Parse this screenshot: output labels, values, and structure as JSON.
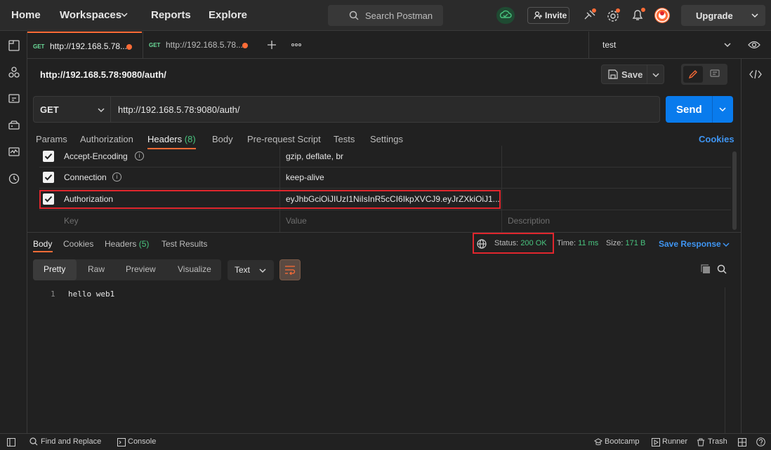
{
  "nav": {
    "home": "Home",
    "workspaces": "Workspaces",
    "reports": "Reports",
    "explore": "Explore",
    "search_placeholder": "Search Postman",
    "invite": "Invite",
    "upgrade": "Upgrade"
  },
  "tabs": [
    {
      "method": "GET",
      "url": "http://192.168.5.78...",
      "active": true
    },
    {
      "method": "GET",
      "url": "http://192.168.5.78...",
      "active": false
    }
  ],
  "environment": "test",
  "request": {
    "title": "http://192.168.5.78:9080/auth/",
    "save_label": "Save",
    "method": "GET",
    "url": "http://192.168.5.78:9080/auth/",
    "send_label": "Send"
  },
  "request_tabs": {
    "params": "Params",
    "authorization": "Authorization",
    "headers": "Headers",
    "headers_count": "(8)",
    "body": "Body",
    "prerequest": "Pre-request Script",
    "tests": "Tests",
    "settings": "Settings",
    "cookies": "Cookies"
  },
  "headers": {
    "rows": [
      {
        "key": "Accept-Encoding",
        "value": "gzip, deflate, br",
        "checked": true,
        "info": true
      },
      {
        "key": "Connection",
        "value": "keep-alive",
        "checked": true,
        "info": true
      },
      {
        "key": "Authorization",
        "value": "eyJhbGciOiJIUzI1NiIsInR5cCI6IkpXVCJ9.eyJrZXkiOiJ1...",
        "checked": true,
        "info": false
      }
    ],
    "placeholder_key": "Key",
    "placeholder_value": "Value",
    "placeholder_description": "Description"
  },
  "response_tabs": {
    "body": "Body",
    "cookies": "Cookies",
    "headers": "Headers",
    "headers_count": "(5)",
    "test_results": "Test Results"
  },
  "response_meta": {
    "status_label": "Status:",
    "status_value": "200 OK",
    "time_label": "Time:",
    "time_value": "11 ms",
    "size_label": "Size:",
    "size_value": "171 B",
    "save_response": "Save Response"
  },
  "view_modes": {
    "pretty": "Pretty",
    "raw": "Raw",
    "preview": "Preview",
    "visualize": "Visualize",
    "format": "Text"
  },
  "response_body": {
    "line_number": "1",
    "code": "hello web1"
  },
  "footer": {
    "find_replace": "Find and Replace",
    "console": "Console",
    "bootcamp": "Bootcamp",
    "runner": "Runner",
    "trash": "Trash"
  },
  "colors": {
    "accent": "#ff6c37",
    "send": "#097bed",
    "success": "#49c47f",
    "highlight_box": "#e0262d"
  }
}
